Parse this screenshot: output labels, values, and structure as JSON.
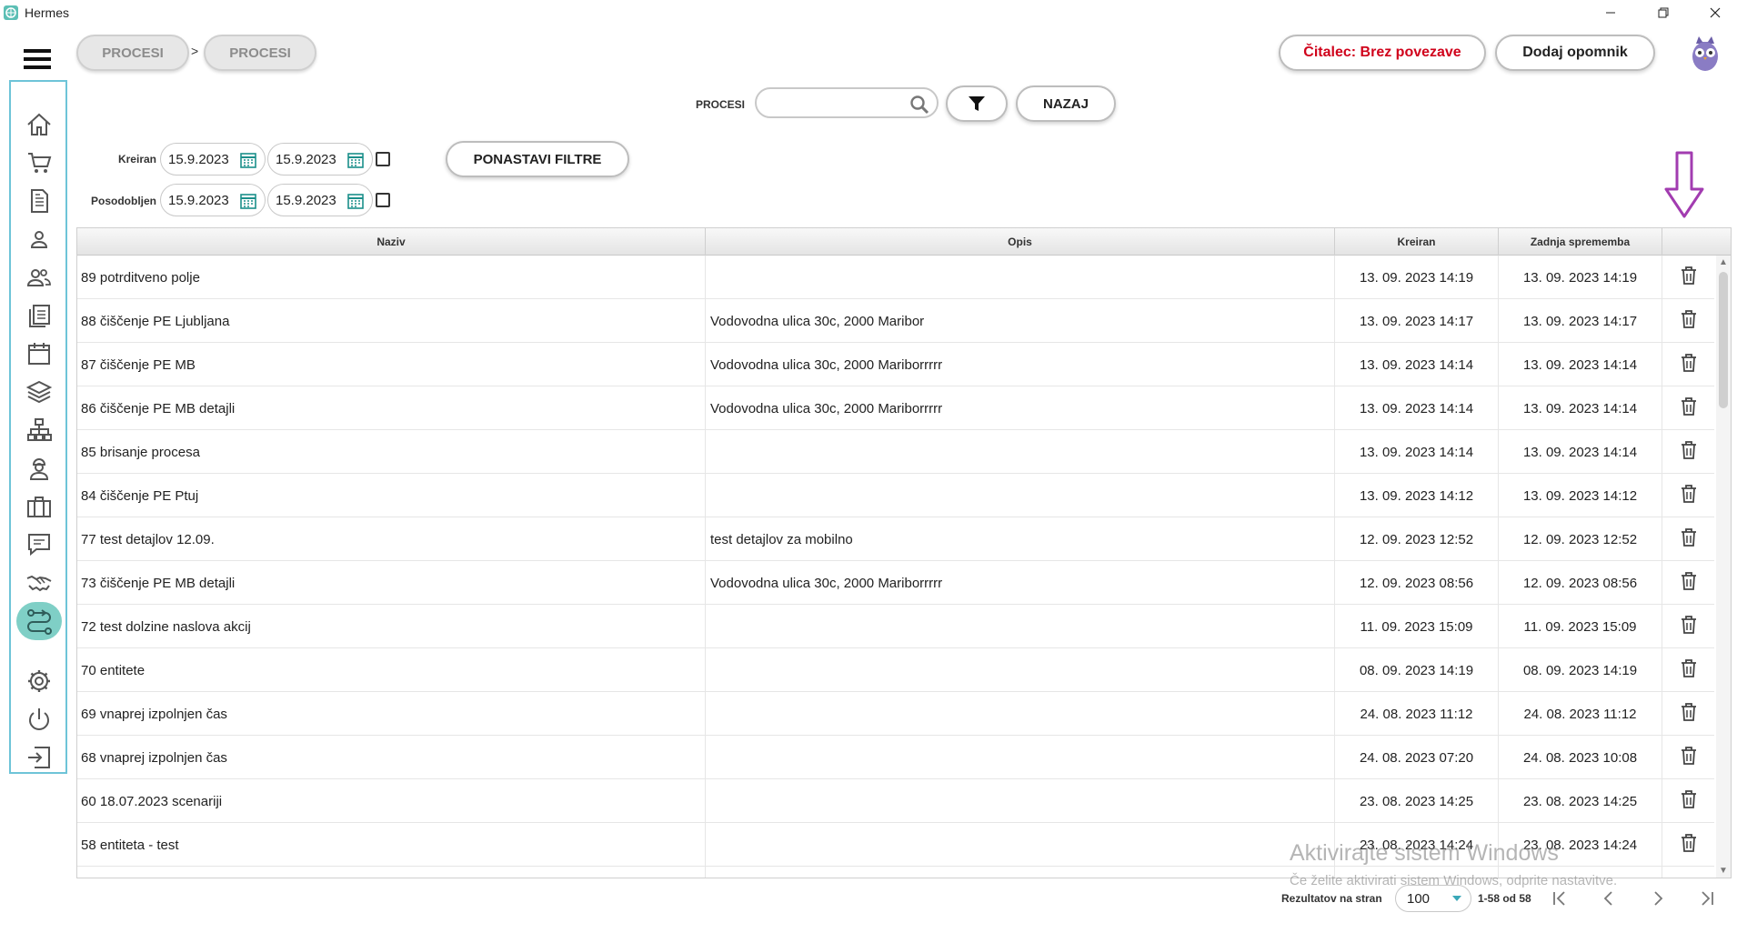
{
  "window": {
    "title": "Hermes"
  },
  "breadcrumb": {
    "items": [
      "PROCESI",
      "PROCESI"
    ],
    "separator": ">"
  },
  "header": {
    "reader_status": "Čitalec: Brez povezave",
    "add_reminder": "Dodaj opomnik"
  },
  "search": {
    "label": "PROCESI",
    "value": "",
    "placeholder": "",
    "back_label": "NAZAJ"
  },
  "filters": {
    "created_label": "Kreiran",
    "updated_label": "Posodobljen",
    "created_from": "15.9.2023",
    "created_to": "15.9.2023",
    "updated_from": "15.9.2023",
    "updated_to": "15.9.2023",
    "reset_label": "PONASTAVI FILTRE"
  },
  "sidebar": {
    "items": [
      {
        "icon": "home-icon"
      },
      {
        "icon": "cart-icon"
      },
      {
        "icon": "document-icon"
      },
      {
        "icon": "person-icon"
      },
      {
        "icon": "people-icon"
      },
      {
        "icon": "list-icon"
      },
      {
        "icon": "calendar-icon"
      },
      {
        "icon": "layers-icon"
      },
      {
        "icon": "org-chart-icon"
      },
      {
        "icon": "worker-icon"
      },
      {
        "icon": "briefcase-icon"
      },
      {
        "icon": "chat-icon"
      },
      {
        "icon": "handshake-icon"
      },
      {
        "icon": "process-icon",
        "active": true
      },
      {
        "icon": "gear-icon"
      },
      {
        "icon": "power-icon"
      },
      {
        "icon": "logout-icon"
      }
    ],
    "accent": "#7fcfc6",
    "border": "#6ec4d8"
  },
  "table": {
    "columns": [
      "Naziv",
      "Opis",
      "Kreiran",
      "Zadnja sprememba"
    ],
    "rows": [
      {
        "naziv": "89 potrditveno polje",
        "opis": "",
        "kreiran": "13. 09. 2023 14:19",
        "zadnja": "13. 09. 2023 14:19"
      },
      {
        "naziv": "88 čiščenje PE Ljubljana",
        "opis": "Vodovodna ulica 30c, 2000 Maribor",
        "kreiran": "13. 09. 2023 14:17",
        "zadnja": "13. 09. 2023 14:17"
      },
      {
        "naziv": "87 čiščenje PE MB",
        "opis": "Vodovodna ulica 30c, 2000 Mariborrrrr",
        "kreiran": "13. 09. 2023 14:14",
        "zadnja": "13. 09. 2023 14:14"
      },
      {
        "naziv": "86 čiščenje PE MB detajli",
        "opis": "Vodovodna ulica 30c, 2000 Mariborrrrr",
        "kreiran": "13. 09. 2023 14:14",
        "zadnja": "13. 09. 2023 14:14"
      },
      {
        "naziv": "85 brisanje procesa",
        "opis": "",
        "kreiran": "13. 09. 2023 14:14",
        "zadnja": "13. 09. 2023 14:14"
      },
      {
        "naziv": "84 čiščenje PE Ptuj",
        "opis": "",
        "kreiran": "13. 09. 2023 14:12",
        "zadnja": "13. 09. 2023 14:12"
      },
      {
        "naziv": "77 test detajlov 12.09.",
        "opis": "test detajlov za mobilno",
        "kreiran": "12. 09. 2023 12:52",
        "zadnja": "12. 09. 2023 12:52"
      },
      {
        "naziv": "73 čiščenje PE MB detajli",
        "opis": "Vodovodna ulica 30c, 2000 Mariborrrrr",
        "kreiran": "12. 09. 2023 08:56",
        "zadnja": "12. 09. 2023 08:56"
      },
      {
        "naziv": "72 test dolzine naslova akcij",
        "opis": "",
        "kreiran": "11. 09. 2023 15:09",
        "zadnja": "11. 09. 2023 15:09"
      },
      {
        "naziv": "70 entitete",
        "opis": "",
        "kreiran": "08. 09. 2023 14:19",
        "zadnja": "08. 09. 2023 14:19"
      },
      {
        "naziv": "69 vnaprej izpolnjen čas",
        "opis": "",
        "kreiran": "24. 08. 2023 11:12",
        "zadnja": "24. 08. 2023 11:12"
      },
      {
        "naziv": "68 vnaprej izpolnjen čas",
        "opis": "",
        "kreiran": "24. 08. 2023 07:20",
        "zadnja": "24. 08. 2023 10:08"
      },
      {
        "naziv": "60 18.07.2023 scenariji",
        "opis": "",
        "kreiran": "23. 08. 2023 14:25",
        "zadnja": "23. 08. 2023 14:25"
      },
      {
        "naziv": "58 entiteta - test",
        "opis": "",
        "kreiran": "23. 08. 2023 14:24",
        "zadnja": "23. 08. 2023 14:24"
      },
      {
        "naziv": "",
        "opis": "",
        "kreiran": "",
        "zadnja": ""
      }
    ]
  },
  "pagination": {
    "per_page_label": "Rezultatov na stran",
    "per_page": "100",
    "range": "1-58 od 58"
  },
  "watermark": {
    "line1": "Aktivirajte sistem Windows",
    "line2": "Če želite aktivirati sistem Windows, odprite nastavitve."
  },
  "colors": {
    "arrow": "#a23cb0",
    "reader_status": "#d0021b",
    "calendar": "#1b8f8a"
  }
}
